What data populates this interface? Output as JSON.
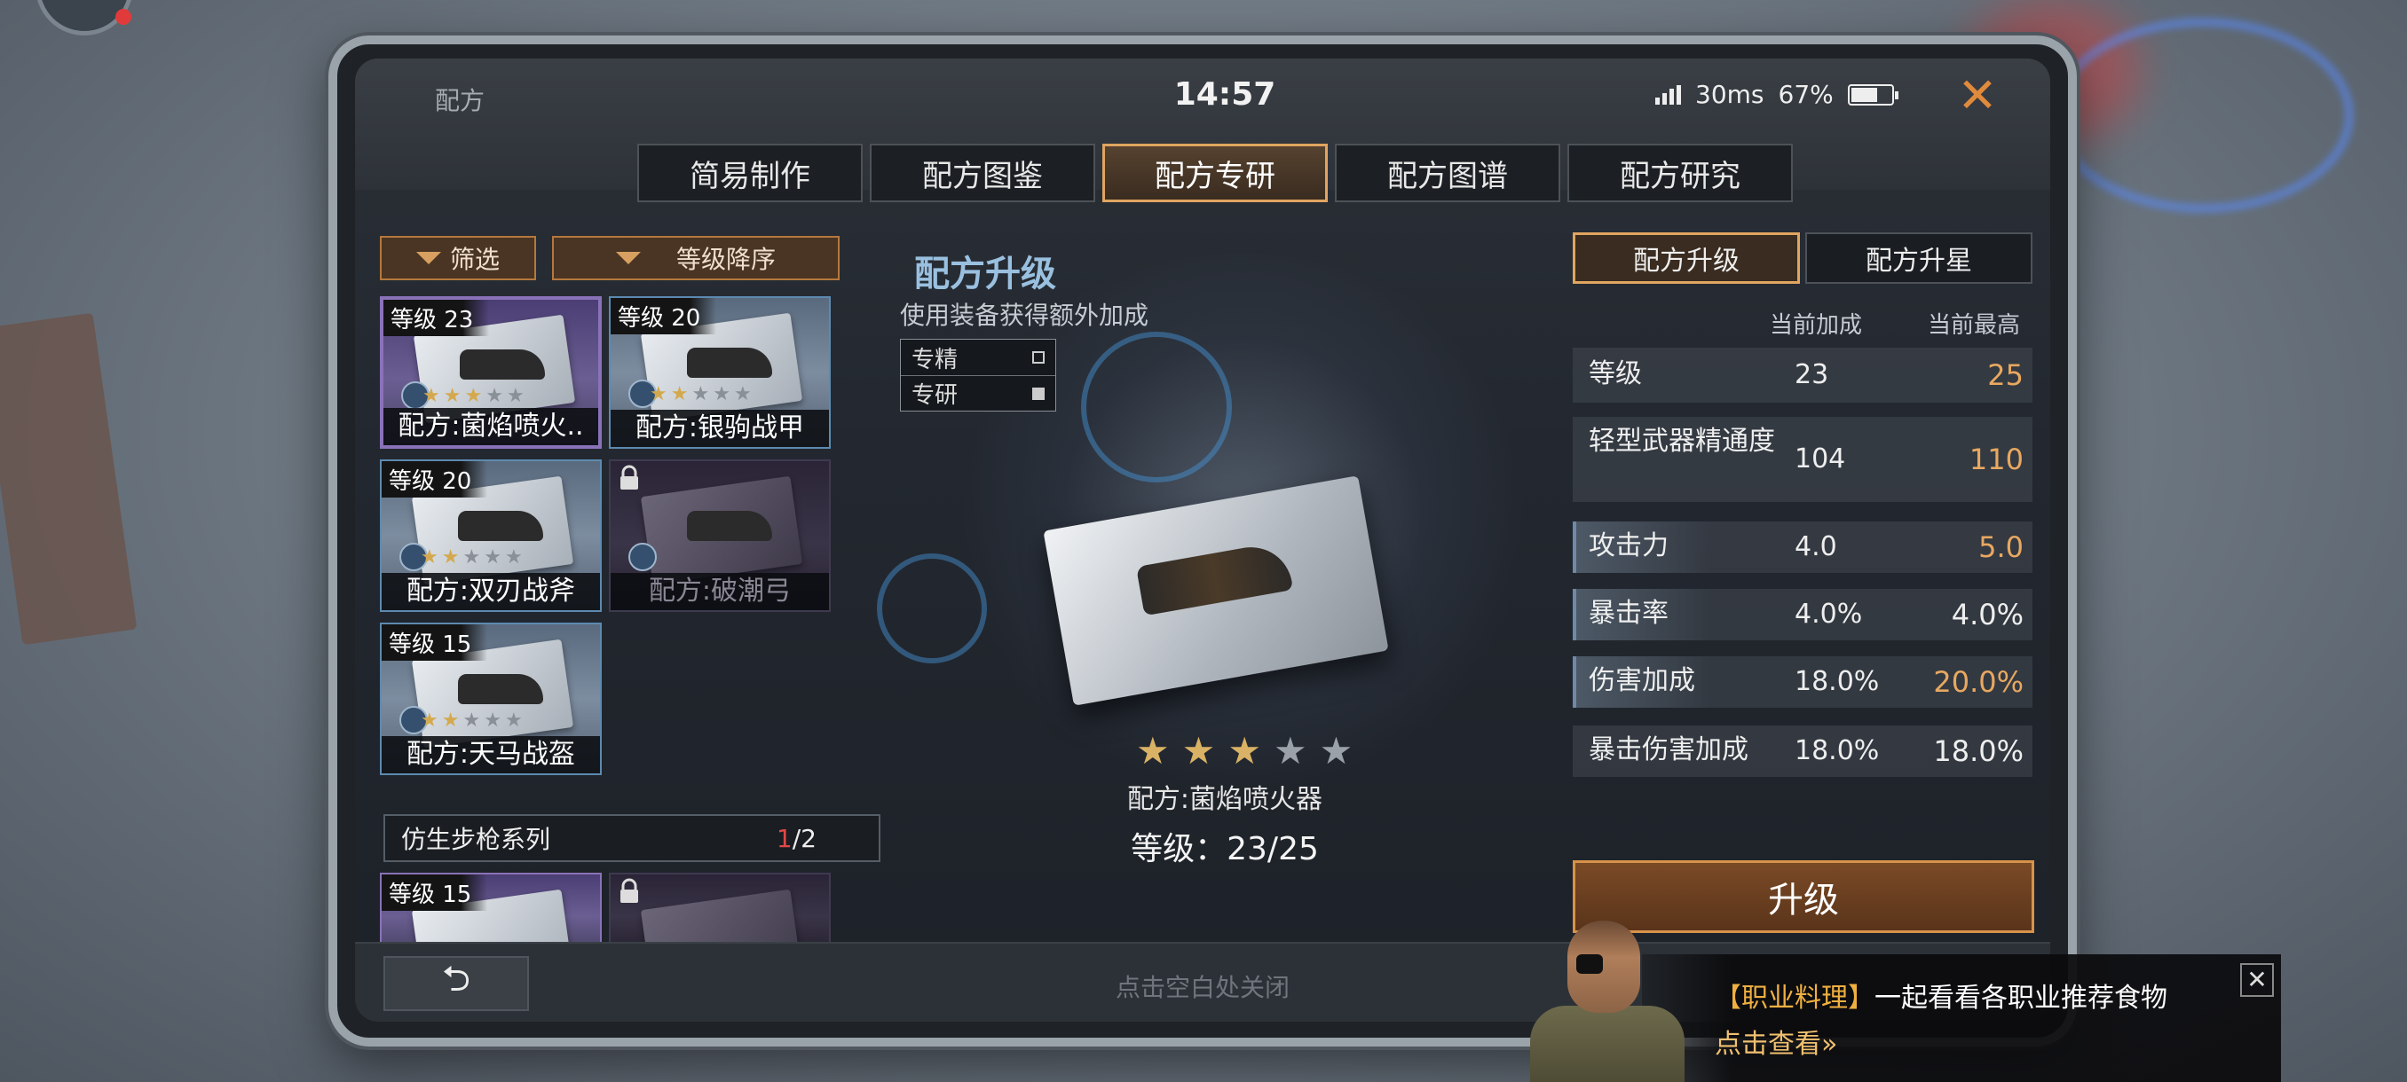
{
  "status_bar": {
    "app": "配方",
    "time": "14:57",
    "ping": "30ms",
    "battery": "67%",
    "battery_level": 0.67
  },
  "tabs": [
    {
      "label": "简易制作",
      "active": false
    },
    {
      "label": "配方图鉴",
      "active": false
    },
    {
      "label": "配方专研",
      "active": true
    },
    {
      "label": "配方图谱",
      "active": false
    },
    {
      "label": "配方研究",
      "active": false
    }
  ],
  "filters": {
    "filter_label": "筛选",
    "sort_label": "等级降序"
  },
  "recipes": [
    {
      "level": "等级 23",
      "name": "配方:菌焰喷火..",
      "stars": 3,
      "max_stars": 5,
      "selected": true,
      "locked": false
    },
    {
      "level": "等级 20",
      "name": "配方:银驹战甲",
      "stars": 2,
      "max_stars": 5,
      "selected": false,
      "locked": false
    },
    {
      "level": "等级 20",
      "name": "配方:双刃战斧",
      "stars": 2,
      "max_stars": 5,
      "selected": false,
      "locked": false
    },
    {
      "level": "",
      "name": "配方:破潮弓",
      "stars": 0,
      "max_stars": 5,
      "selected": false,
      "locked": true
    },
    {
      "level": "等级 15",
      "name": "配方:天马战盔",
      "stars": 2,
      "max_stars": 5,
      "selected": false,
      "locked": false
    }
  ],
  "series": {
    "name": "仿生步枪系列",
    "current": "1",
    "total": "/2"
  },
  "series_recipes": [
    {
      "level": "等级 15",
      "locked": false
    },
    {
      "level": "",
      "locked": true
    }
  ],
  "center": {
    "title": "配方升级",
    "subtitle": "使用装备获得额外加成",
    "modes": [
      {
        "label": "专精",
        "checked": false
      },
      {
        "label": "专研",
        "checked": true
      }
    ],
    "item_name": "配方:菌焰喷火器",
    "item_level": "等级：23/25",
    "stars": 3,
    "max_stars": 5
  },
  "right_panel": {
    "subtabs": [
      {
        "label": "配方升级",
        "active": true
      },
      {
        "label": "配方升星",
        "active": false
      }
    ],
    "col_current": "当前加成",
    "col_max": "当前最高",
    "stats": [
      {
        "name": "等级",
        "current": "23",
        "max": "25",
        "up": true,
        "fill": 0
      },
      {
        "name": "轻型武器精通度",
        "current": "104",
        "max": "110",
        "up": true,
        "fill": 0
      },
      {
        "name": "攻击力",
        "current": "4.0",
        "max": "5.0",
        "up": true,
        "fill": 0.3
      },
      {
        "name": "暴击率",
        "current": "4.0%",
        "max": "4.0%",
        "up": false,
        "fill": 0.3
      },
      {
        "name": "伤害加成",
        "current": "18.0%",
        "max": "20.0%",
        "up": true,
        "fill": 0.3
      },
      {
        "name": "暴击伤害加成",
        "current": "18.0%",
        "max": "18.0%",
        "up": false,
        "fill": 0
      }
    ],
    "upgrade_label": "升级"
  },
  "bottom": {
    "back_glyph": "⮌",
    "close_hint": "点击空白处关闭"
  },
  "notification": {
    "tag": "【职业料理】",
    "text": "一起看看各职业推荐食物",
    "link": "点击查看»",
    "close": "✕"
  },
  "colors": {
    "accent": "#e0a560",
    "highlight": "#e8a860",
    "star": "#d9b265",
    "title_blue": "#9ac0e0"
  }
}
